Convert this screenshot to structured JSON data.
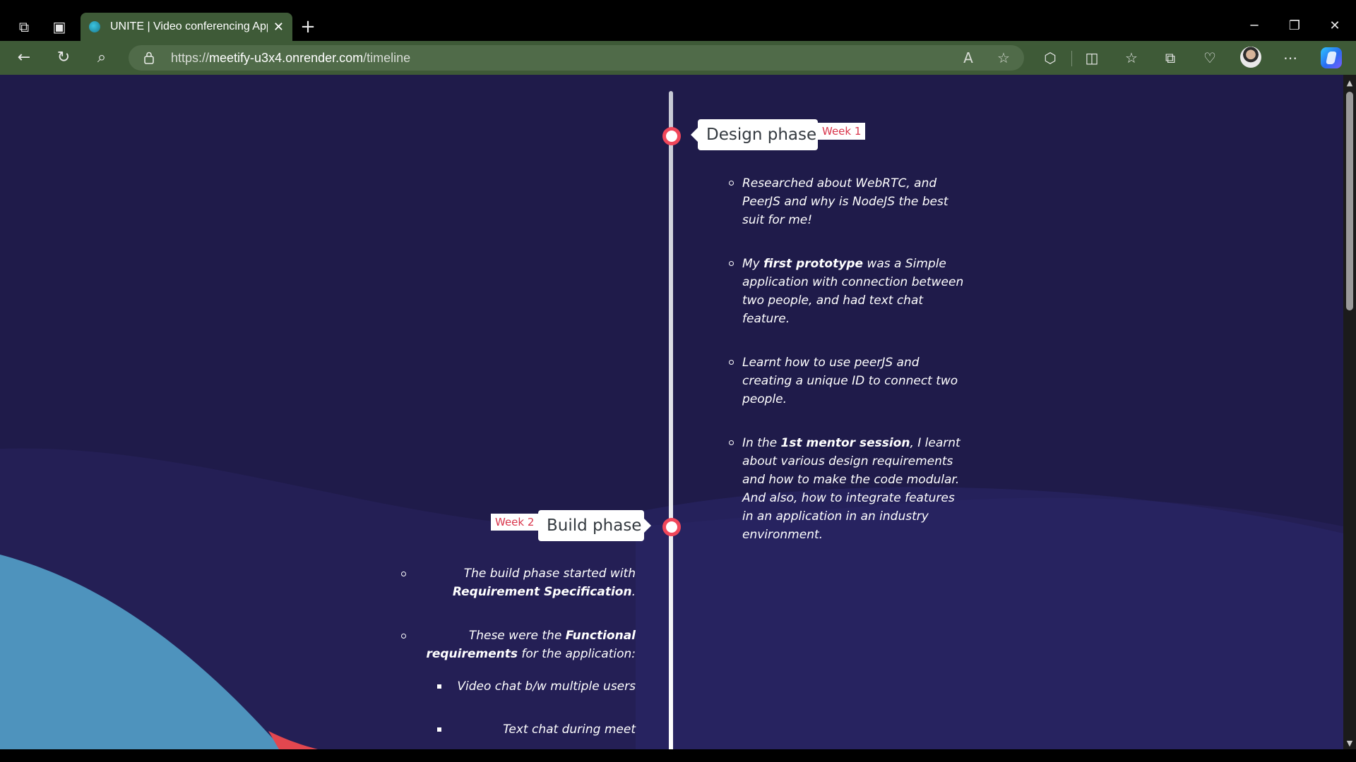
{
  "browser": {
    "tab_title": "UNITE | Video conferencing App",
    "url_prefix": "https://",
    "url_host": "meetify-u3x4.onrender.com",
    "url_path": "/timeline",
    "icons": {
      "workspaces": "⧉",
      "tab_actions": "▣",
      "tab_close": "✕",
      "new_tab": "+",
      "minimize": "─",
      "restore": "❐",
      "close": "✕",
      "back": "←",
      "refresh": "↻",
      "search": "⌕",
      "read_aloud": "A",
      "favorite": "☆",
      "extensions": "⬡",
      "split_screen": "◫",
      "favorites": "☆",
      "collections": "⧉",
      "performance": "♡",
      "more": "⋯"
    }
  },
  "timeline": {
    "phases": [
      {
        "title": "Design phase",
        "week": "Week 1",
        "items": [
          {
            "parts": [
              "Researched about WebRTC, and PeerJS and why is NodeJS the best suit for me!"
            ]
          },
          {
            "pre": "My ",
            "bold": "first prototype",
            "post": " was a Simple application with connection between two people, and had text chat feature."
          },
          {
            "parts": [
              "Learnt how to use peerJS and creating a unique ID to connect two people."
            ]
          },
          {
            "pre": "In the ",
            "bold": "1st mentor session",
            "post": ", I learnt about various design requirements and how to make the code modular. And also, how to integrate features in an application in an industry environment."
          }
        ]
      },
      {
        "title": "Build phase",
        "week": "Week 2",
        "items": [
          {
            "line1": "The build phase started with",
            "line2_bold": "Requirement Specification",
            "line2_post": "."
          },
          {
            "line1_pre": "These were the ",
            "line1_bold": "Functional",
            "line2_bold": "requirements",
            "line2_post": " for the application:"
          },
          {
            "sub": "Video chat b/w multiple users"
          },
          {
            "sub": "Text chat during meet"
          }
        ]
      }
    ]
  },
  "colors": {
    "page_bg": "#1f1b4a",
    "accent_dot": "#f0475a",
    "week_text": "#d9364c",
    "browser_green": "#3e5a37"
  }
}
